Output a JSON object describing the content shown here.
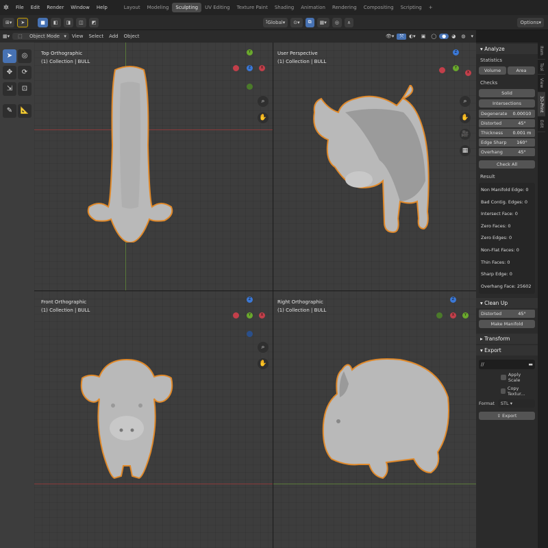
{
  "menu": [
    "File",
    "Edit",
    "Render",
    "Window",
    "Help"
  ],
  "workspaces": [
    "Layout",
    "Modeling",
    "Sculpting",
    "UV Editing",
    "Texture Paint",
    "Shading",
    "Animation",
    "Rendering",
    "Compositing",
    "Scripting"
  ],
  "active_workspace": "Sculpting",
  "toolbar": {
    "transform": "Global",
    "options_label": "Options"
  },
  "header": {
    "mode": "Object Mode",
    "view": "View",
    "select": "Select",
    "add": "Add",
    "object": "Object"
  },
  "viewports": [
    {
      "title": "Top Orthographic",
      "subtitle": "(1) Collection | BULL"
    },
    {
      "title": "User Perspective",
      "subtitle": "(1) Collection | BULL"
    },
    {
      "title": "Front Orthographic",
      "subtitle": "(1) Collection | BULL"
    },
    {
      "title": "Right Orthographic",
      "subtitle": "(1) Collection | BULL"
    }
  ],
  "sidebar": {
    "analyze": "Analyze",
    "statistics": "Statistics",
    "volume": "Volume",
    "area": "Area",
    "checks": "Checks",
    "solid": "Solid",
    "intersections": "Intersections",
    "degenerate_label": "Degenerate",
    "degenerate_value": "0.00010",
    "distorted_label": "Distorted",
    "distorted_value": "45°",
    "thickness_label": "Thickness",
    "thickness_value": "0.001 m",
    "edge_sharp_label": "Edge Sharp",
    "edge_sharp_value": "160°",
    "overhang_label": "Overhang",
    "overhang_value": "45°",
    "check_all": "Check All",
    "result": "Result",
    "results": [
      "Non Manifold Edge: 0",
      "Bad Contig. Edges: 0",
      "Intersect Face: 0",
      "Zero Faces: 0",
      "Zero Edges: 0",
      "Non-Flat Faces: 0",
      "Thin Faces: 0",
      "Sharp Edge: 0",
      "Overhang Face: 25602"
    ],
    "clean_up": "Clean Up",
    "cu_distorted_label": "Distorted",
    "cu_distorted_value": "45°",
    "make_manifold": "Make Manifold",
    "transform": "Transform",
    "export": "Export",
    "export_path": "//",
    "apply_scale": "Apply Scale",
    "copy_textures": "Copy Textur...",
    "format_label": "Format",
    "format_value": "STL",
    "export_button": "Export"
  },
  "side_tabs": [
    "Item",
    "Tool",
    "View",
    "3D-Print",
    "Edit"
  ],
  "colors": {
    "accent": "#4772b3",
    "outline": "#e0892a",
    "model": "#b9b9b9",
    "viewport_bg": "#3d3d3d"
  }
}
